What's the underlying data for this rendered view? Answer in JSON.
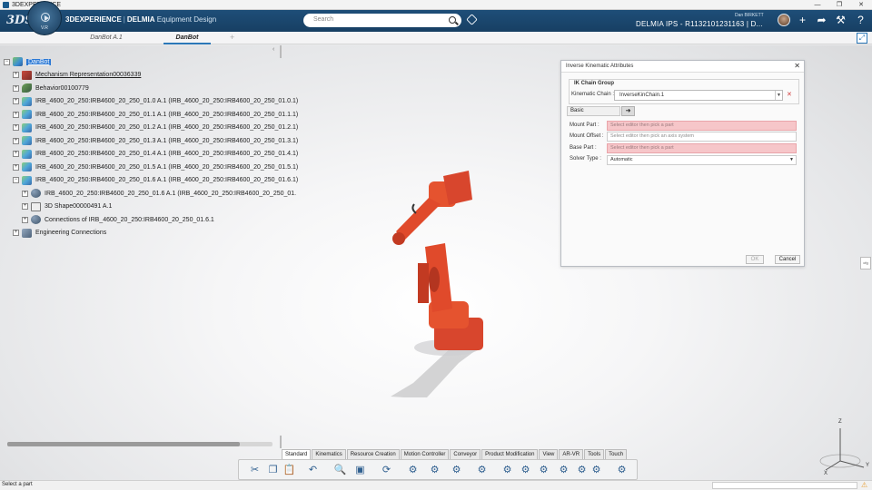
{
  "window": {
    "title": "3DEXPERIENCE",
    "controls": [
      "—",
      "❐",
      "✕"
    ]
  },
  "header": {
    "logo": "3DS",
    "compass_version": "V.R",
    "brand_bold": "3DEXPERIENCE",
    "brand_sep": "|",
    "brand_app": "DELMIA",
    "brand_product": "Equipment Design",
    "search_placeholder": "Search",
    "user_name": "Dan BIRKETT",
    "context": "DELMIA IPS - R1132101231163 | D..."
  },
  "tabs": [
    {
      "label": "DanBot A.1",
      "active": false
    },
    {
      "label": "DanBot",
      "active": true
    }
  ],
  "tab_add": "+",
  "tree": {
    "nodes": [
      {
        "exp": "−",
        "icon": "prod",
        "label": "DanBot",
        "style": "sel"
      },
      {
        "exp": "+",
        "icon": "mech",
        "label": "Mechanism Representation00036339",
        "style": "ul"
      },
      {
        "exp": "+",
        "icon": "behav",
        "label": "Behavior00100779",
        "style": ""
      },
      {
        "exp": "+",
        "icon": "part",
        "label": "IRB_4600_20_250:IRB4600_20_250_01.0 A.1 (IRB_4600_20_250:IRB4600_20_250_01.0.1)",
        "style": ""
      },
      {
        "exp": "+",
        "icon": "part",
        "label": "IRB_4600_20_250:IRB4600_20_250_01.1 A.1 (IRB_4600_20_250:IRB4600_20_250_01.1.1)",
        "style": ""
      },
      {
        "exp": "+",
        "icon": "part",
        "label": "IRB_4600_20_250:IRB4600_20_250_01.2 A.1 (IRB_4600_20_250:IRB4600_20_250_01.2.1)",
        "style": ""
      },
      {
        "exp": "+",
        "icon": "part",
        "label": "IRB_4600_20_250:IRB4600_20_250_01.3 A.1 (IRB_4600_20_250:IRB4600_20_250_01.3.1)",
        "style": ""
      },
      {
        "exp": "+",
        "icon": "part",
        "label": "IRB_4600_20_250:IRB4600_20_250_01.4 A.1 (IRB_4600_20_250:IRB4600_20_250_01.4.1)",
        "style": ""
      },
      {
        "exp": "+",
        "icon": "part",
        "label": "IRB_4600_20_250:IRB4600_20_250_01.5 A.1 (IRB_4600_20_250:IRB4600_20_250_01.5.1)",
        "style": ""
      },
      {
        "exp": "−",
        "icon": "part",
        "label": "IRB_4600_20_250:IRB4600_20_250_01.6 A.1 (IRB_4600_20_250:IRB4600_20_250_01.6.1)",
        "style": ""
      },
      {
        "exp": "+",
        "icon": "conn",
        "label": "IRB_4600_20_250:IRB4600_20_250_01.6 A.1 (IRB_4600_20_250:IRB4600_20_250_01.",
        "style": ""
      },
      {
        "exp": "+",
        "icon": "shape",
        "label": "3D Shape00000491 A.1",
        "style": ""
      },
      {
        "exp": "+",
        "icon": "conn",
        "label": "Connections of IRB_4600_20_250:IRB4600_20_250_01.6.1",
        "style": ""
      },
      {
        "exp": "+",
        "icon": "eng",
        "label": "Engineering Connections",
        "style": ""
      }
    ]
  },
  "dialog": {
    "title": "Inverse Kinematic Attributes",
    "group_title": "IK Chain Group",
    "kinematic_chain_label": "Kinematic Chain :",
    "kinematic_chain_value": "InverseKinChain.1",
    "basic_tab": "Basic",
    "fields": [
      {
        "label": "Mount Part :",
        "value": "Select editor then pick a part",
        "state": "err"
      },
      {
        "label": "Mount Offset :",
        "value": "Select editor then pick an axis system",
        "state": "ok"
      },
      {
        "label": "Base Part :",
        "value": "Select editor then pick a part",
        "state": "err"
      },
      {
        "label": "Solver Type :",
        "value": "Automatic",
        "state": "ok"
      }
    ],
    "ok_label": "OK",
    "cancel_label": "Cancel"
  },
  "side_tab": "cfg",
  "triad": {
    "z": "Z",
    "y": "Y",
    "x": "X"
  },
  "action_tabs": [
    {
      "label": "Standard",
      "active": true
    },
    {
      "label": "Kinematics",
      "active": false
    },
    {
      "label": "Resource Creation",
      "active": false
    },
    {
      "label": "Motion Controller",
      "active": false
    },
    {
      "label": "Conveyor",
      "active": false
    },
    {
      "label": "Product Modification",
      "active": false
    },
    {
      "label": "View",
      "active": false
    },
    {
      "label": "AR-VR",
      "active": false
    },
    {
      "label": "Tools",
      "active": false
    },
    {
      "label": "Touch",
      "active": false
    }
  ],
  "toolbar_icons": [
    "cut-icon",
    "copy-icon",
    "paste-icon",
    "undo-icon",
    "zoom-icon",
    "view-mode-icon",
    "update-icon",
    "mechanism-icon",
    "joint-icon",
    "command-icon",
    "kinematic-chain-icon",
    "sensor-icon",
    "robot-icon",
    "inverse-kinematics-icon",
    "simulate-icon",
    "teach-icon",
    "analysis-icon",
    "play-icon"
  ],
  "status": {
    "text": "Select a part"
  },
  "colors": {
    "accent": "#2b78b8",
    "topbar": "#1e4e78",
    "robot": "#e0452a",
    "error_field": "#f6c6c9"
  }
}
